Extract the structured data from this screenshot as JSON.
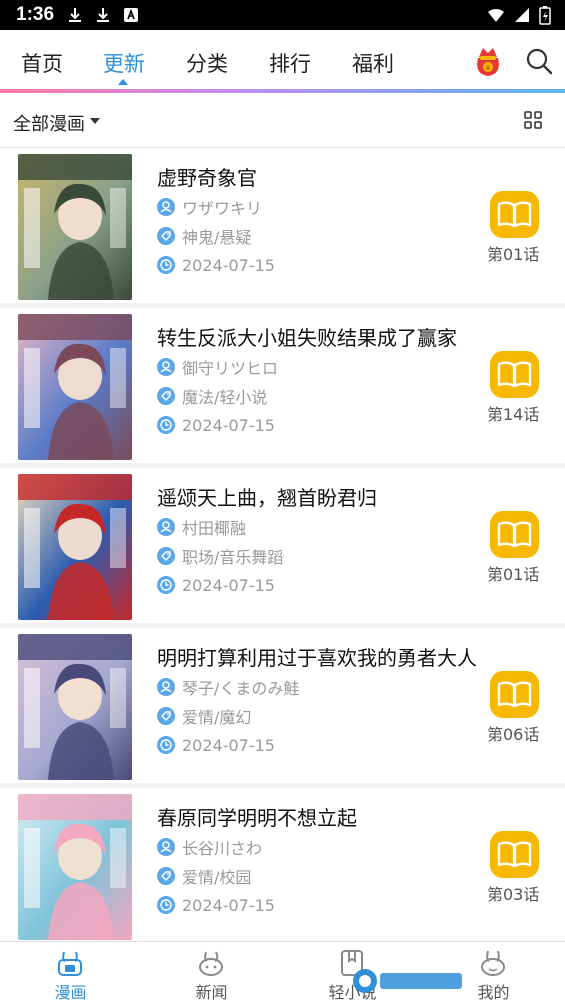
{
  "status_bar": {
    "time": "1:36"
  },
  "top_nav": {
    "tabs": [
      {
        "label": "首页",
        "active": false
      },
      {
        "label": "更新",
        "active": true
      },
      {
        "label": "分类",
        "active": false
      },
      {
        "label": "排行",
        "active": false
      },
      {
        "label": "福利",
        "active": false
      }
    ]
  },
  "filter": {
    "label": "全部漫画"
  },
  "comics": [
    {
      "title": "虚野奇象官",
      "author": "ワザワキリ",
      "tags": "神鬼/悬疑",
      "date": "2024-07-15",
      "chapter": "第01话",
      "cover_colors": [
        "#3a4a3a",
        "#c9b76a",
        "#8aa08a"
      ]
    },
    {
      "title": "转生反派大小姐失败结果成了赢家",
      "author": "御守リツヒロ",
      "tags": "魔法/轻小说",
      "date": "2024-07-15",
      "chapter": "第14话",
      "cover_colors": [
        "#7a4a5a",
        "#e9b8c6",
        "#5a7cc8"
      ]
    },
    {
      "title": "遥颂天上曲，翘首盼君归",
      "author": "村田椰融",
      "tags": "职场/音乐舞蹈",
      "date": "2024-07-15",
      "chapter": "第01话",
      "cover_colors": [
        "#c62828",
        "#f3e0c0",
        "#2b5cb0"
      ]
    },
    {
      "title": "明明打算利用过于喜欢我的勇者大人",
      "author": "琴子/くまのみ鮭",
      "tags": "爱情/魔幻",
      "date": "2024-07-15",
      "chapter": "第06话",
      "cover_colors": [
        "#4a4a7a",
        "#d8c0d8",
        "#a5a8d0"
      ]
    },
    {
      "title": "春原同学明明不想立起",
      "author": "长谷川さわ",
      "tags": "爱情/校园",
      "date": "2024-07-15",
      "chapter": "第03话",
      "cover_colors": [
        "#f3a7c0",
        "#d9eef6",
        "#7fc3d8"
      ]
    }
  ],
  "bottom_nav": {
    "items": [
      {
        "label": "漫画",
        "active": true
      },
      {
        "label": "新闻",
        "active": false
      },
      {
        "label": "轻小说",
        "active": false
      },
      {
        "label": "我的",
        "active": false
      }
    ]
  },
  "colors": {
    "accent": "#2f8fd8",
    "read_button": "#f6b800",
    "meta_icon": "#5aa7ea"
  }
}
